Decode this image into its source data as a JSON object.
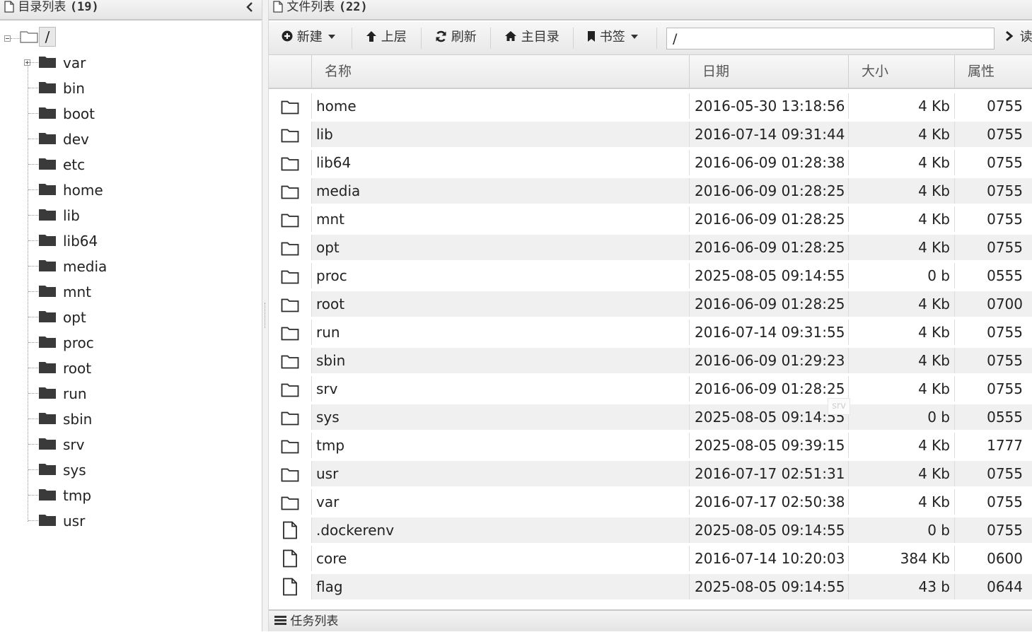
{
  "dir_panel": {
    "title": "目录列表",
    "count": "(19)"
  },
  "tree": {
    "root": "/",
    "items": [
      "var",
      "bin",
      "boot",
      "dev",
      "etc",
      "home",
      "lib",
      "lib64",
      "media",
      "mnt",
      "opt",
      "proc",
      "root",
      "run",
      "sbin",
      "srv",
      "sys",
      "tmp",
      "usr"
    ]
  },
  "file_panel": {
    "title": "文件列表",
    "count": "(22)"
  },
  "toolbar": {
    "new_label": "新建",
    "up_label": "上层",
    "refresh_label": "刷新",
    "home_label": "主目录",
    "bookmark_label": "书签",
    "path_value": "/",
    "go_label": "读"
  },
  "columns": {
    "name": "名称",
    "date": "日期",
    "size": "大小",
    "attr": "属性"
  },
  "files": [
    {
      "name": "home",
      "date": "2016-05-30 13:18:56",
      "size": "4 Kb",
      "attr": "0755",
      "type": "folder"
    },
    {
      "name": "lib",
      "date": "2016-07-14 09:31:44",
      "size": "4 Kb",
      "attr": "0755",
      "type": "folder"
    },
    {
      "name": "lib64",
      "date": "2016-06-09 01:28:38",
      "size": "4 Kb",
      "attr": "0755",
      "type": "folder"
    },
    {
      "name": "media",
      "date": "2016-06-09 01:28:25",
      "size": "4 Kb",
      "attr": "0755",
      "type": "folder"
    },
    {
      "name": "mnt",
      "date": "2016-06-09 01:28:25",
      "size": "4 Kb",
      "attr": "0755",
      "type": "folder"
    },
    {
      "name": "opt",
      "date": "2016-06-09 01:28:25",
      "size": "4 Kb",
      "attr": "0755",
      "type": "folder"
    },
    {
      "name": "proc",
      "date": "2025-08-05 09:14:55",
      "size": "0 b",
      "attr": "0555",
      "type": "folder"
    },
    {
      "name": "root",
      "date": "2016-06-09 01:28:25",
      "size": "4 Kb",
      "attr": "0700",
      "type": "folder"
    },
    {
      "name": "run",
      "date": "2016-07-14 09:31:55",
      "size": "4 Kb",
      "attr": "0755",
      "type": "folder"
    },
    {
      "name": "sbin",
      "date": "2016-06-09 01:29:23",
      "size": "4 Kb",
      "attr": "0755",
      "type": "folder"
    },
    {
      "name": "srv",
      "date": "2016-06-09 01:28:25",
      "size": "4 Kb",
      "attr": "0755",
      "type": "folder"
    },
    {
      "name": "sys",
      "date": "2025-08-05 09:14:55",
      "size": "0 b",
      "attr": "0555",
      "type": "folder"
    },
    {
      "name": "tmp",
      "date": "2025-08-05 09:39:15",
      "size": "4 Kb",
      "attr": "1777",
      "type": "folder"
    },
    {
      "name": "usr",
      "date": "2016-07-17 02:51:31",
      "size": "4 Kb",
      "attr": "0755",
      "type": "folder"
    },
    {
      "name": "var",
      "date": "2016-07-17 02:50:38",
      "size": "4 Kb",
      "attr": "0755",
      "type": "folder"
    },
    {
      "name": ".dockerenv",
      "date": "2025-08-05 09:14:55",
      "size": "0 b",
      "attr": "0755",
      "type": "file"
    },
    {
      "name": "core",
      "date": "2016-07-14 10:20:03",
      "size": "384 Kb",
      "attr": "0600",
      "type": "file"
    },
    {
      "name": "flag",
      "date": "2025-08-05 09:14:55",
      "size": "43 b",
      "attr": "0644",
      "type": "file"
    }
  ],
  "drag_ghost": "srv",
  "task_panel": {
    "title": "任务列表"
  },
  "icons": {
    "folder_tree": "folder-filled-icon",
    "folder_row": "folder-outline-icon",
    "file_row": "file-outline-icon"
  }
}
